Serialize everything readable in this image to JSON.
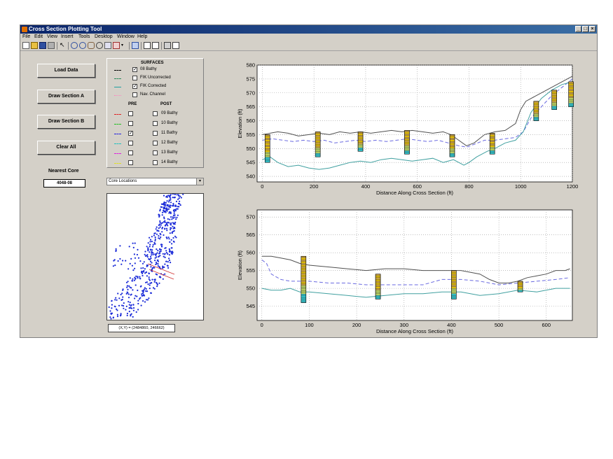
{
  "window": {
    "title": "Cross Section Plotting Tool",
    "controls": [
      "_",
      "□",
      "×"
    ]
  },
  "menu": [
    "File",
    "Edit",
    "View",
    "Insert",
    "Tools",
    "Desktop",
    "Window",
    "Help"
  ],
  "buttons": {
    "load": "Load Data",
    "section_a": "Draw Section A",
    "section_b": "Draw Section B",
    "clear": "Clear All"
  },
  "nearest_core": {
    "label": "Nearest Core",
    "value": "4048-08"
  },
  "surfaces": {
    "header": "SURFACES",
    "items": [
      {
        "label": "08 Bathy",
        "checked": true,
        "color": "#000000",
        "style": "solid"
      },
      {
        "label": "FIK Uncorrected",
        "checked": false,
        "color": "#2a8a5a",
        "style": "solid"
      },
      {
        "label": "FIK Corrected",
        "checked": true,
        "color": "#20a0a0",
        "style": "solid"
      },
      {
        "label": "Nav. Channel",
        "checked": false,
        "color": "#ff80c0",
        "style": "dotted"
      }
    ],
    "pre_header": "PRE",
    "post_header": "POST",
    "rows": [
      {
        "color": "#e02020",
        "pre": false,
        "post": false,
        "label": "09 Bathy"
      },
      {
        "color": "#20c020",
        "pre": false,
        "post": false,
        "label": "10 Bathy"
      },
      {
        "color": "#2020e0",
        "pre": true,
        "post": false,
        "label": "11 Bathy"
      },
      {
        "color": "#20c0c0",
        "pre": false,
        "post": false,
        "label": "12 Bathy"
      },
      {
        "color": "#e020e0",
        "pre": false,
        "post": false,
        "label": "13 Bathy"
      },
      {
        "color": "#e0e020",
        "pre": false,
        "post": false,
        "label": "14 Bathy"
      }
    ]
  },
  "core_dropdown": {
    "value": "Core Locations"
  },
  "coord_readout": "(X,Y) = (2484860, 246662)",
  "chart_data": [
    {
      "type": "line",
      "xlabel": "Distance Along Cross Section (ft)",
      "ylabel": "Elevation (ft)",
      "xlim": [
        -20,
        1200
      ],
      "ylim": [
        538,
        580
      ],
      "xticks": [
        0,
        200,
        400,
        600,
        800,
        1000,
        1200
      ],
      "yticks": [
        540,
        545,
        550,
        555,
        560,
        565,
        570,
        575,
        580
      ],
      "grid": true,
      "series": [
        {
          "color": "#505050",
          "dash": "",
          "x": [
            0,
            30,
            60,
            100,
            140,
            180,
            220,
            260,
            300,
            340,
            380,
            420,
            460,
            500,
            540,
            580,
            620,
            660,
            700,
            730,
            760,
            790,
            820,
            860,
            900,
            940,
            980,
            1000,
            1020,
            1060,
            1100,
            1140,
            1180,
            1200
          ],
          "y": [
            555,
            555.5,
            556,
            555.5,
            554.5,
            555,
            555.5,
            555,
            556,
            555.5,
            556,
            555.5,
            556,
            556.5,
            556,
            556.5,
            556,
            555.5,
            556,
            555,
            553,
            551,
            552,
            555,
            556,
            556.5,
            559,
            564,
            567,
            569,
            571,
            573,
            575,
            576
          ]
        },
        {
          "color": "#6a6ae0",
          "dash": "5,3",
          "x": [
            0,
            40,
            80,
            120,
            160,
            200,
            240,
            280,
            320,
            360,
            400,
            440,
            480,
            520,
            560,
            600,
            640,
            680,
            720,
            760,
            790,
            820,
            860,
            900,
            940,
            980,
            1010,
            1040,
            1080,
            1120,
            1160,
            1200
          ],
          "y": [
            553,
            553.5,
            553,
            552.5,
            553,
            552.5,
            553,
            552,
            552.5,
            553,
            552.5,
            553,
            552.5,
            553,
            553.5,
            553,
            552.5,
            553,
            552,
            551,
            550.5,
            551.5,
            553,
            553,
            553.5,
            554,
            556,
            561,
            565,
            569,
            572,
            575
          ]
        },
        {
          "color": "#40a0a0",
          "dash": "",
          "x": [
            0,
            30,
            60,
            100,
            140,
            180,
            220,
            260,
            300,
            340,
            380,
            420,
            460,
            500,
            540,
            580,
            620,
            660,
            700,
            740,
            780,
            800,
            830,
            870,
            900,
            940,
            980,
            1010,
            1040,
            1080,
            1120,
            1160,
            1200
          ],
          "y": [
            546,
            547,
            545,
            543.5,
            544,
            543,
            542.5,
            543,
            544,
            545,
            545.5,
            545,
            546,
            546.5,
            546,
            545.5,
            546,
            546.5,
            545,
            546,
            544,
            545,
            547,
            549,
            550,
            552,
            553,
            556,
            563,
            568,
            571,
            573,
            574
          ]
        }
      ],
      "cores": [
        {
          "x": 20,
          "top": 555,
          "bottom": 545
        },
        {
          "x": 215,
          "top": 556,
          "bottom": 547
        },
        {
          "x": 380,
          "top": 556,
          "bottom": 549
        },
        {
          "x": 560,
          "top": 556.5,
          "bottom": 548
        },
        {
          "x": 735,
          "top": 555,
          "bottom": 547
        },
        {
          "x": 890,
          "top": 555.5,
          "bottom": 548
        },
        {
          "x": 1060,
          "top": 567,
          "bottom": 560
        },
        {
          "x": 1130,
          "top": 571,
          "bottom": 564
        },
        {
          "x": 1195,
          "top": 574,
          "bottom": 565
        }
      ]
    },
    {
      "type": "line",
      "xlabel": "Distance Along Cross Section (ft)",
      "ylabel": "Elevation (ft)",
      "xlim": [
        -10,
        655
      ],
      "ylim": [
        541,
        572
      ],
      "xticks": [
        0,
        100,
        200,
        300,
        400,
        500,
        600
      ],
      "yticks": [
        545,
        550,
        555,
        560,
        565,
        570
      ],
      "grid": true,
      "series": [
        {
          "color": "#505050",
          "dash": "",
          "x": [
            0,
            20,
            40,
            60,
            80,
            100,
            140,
            180,
            220,
            260,
            300,
            340,
            380,
            420,
            460,
            480,
            500,
            520,
            540,
            560,
            580,
            600,
            620,
            640,
            650
          ],
          "y": [
            559,
            559,
            558.5,
            558,
            557,
            556.5,
            556,
            555.5,
            555,
            555.5,
            555.5,
            555,
            555,
            555,
            554,
            552.5,
            551.5,
            551.5,
            552,
            553,
            553.5,
            554,
            555,
            555,
            555.5
          ]
        },
        {
          "color": "#6a6ae0",
          "dash": "5,3",
          "x": [
            0,
            10,
            20,
            40,
            60,
            80,
            100,
            140,
            180,
            220,
            260,
            300,
            340,
            380,
            420,
            460,
            500,
            540,
            580,
            620,
            650
          ],
          "y": [
            558,
            557,
            554,
            552.5,
            552,
            552,
            552,
            551.5,
            551.5,
            551,
            551,
            551,
            551,
            552.5,
            552.5,
            552,
            551,
            551.5,
            552,
            552.5,
            553
          ]
        },
        {
          "color": "#40a0a0",
          "dash": "",
          "x": [
            0,
            20,
            40,
            60,
            80,
            100,
            140,
            180,
            220,
            260,
            300,
            340,
            380,
            420,
            460,
            500,
            540,
            580,
            620,
            650
          ],
          "y": [
            550,
            549.5,
            549.5,
            550,
            549,
            549,
            548.5,
            548,
            547.5,
            548,
            548.5,
            548.5,
            549,
            549,
            548,
            548.5,
            549.5,
            549,
            550,
            550
          ]
        }
      ],
      "cores": [
        {
          "x": 88,
          "top": 559,
          "bottom": 546
        },
        {
          "x": 245,
          "top": 554,
          "bottom": 547
        },
        {
          "x": 405,
          "top": 555,
          "bottom": 547
        },
        {
          "x": 545,
          "top": 552,
          "bottom": 549
        }
      ]
    }
  ]
}
